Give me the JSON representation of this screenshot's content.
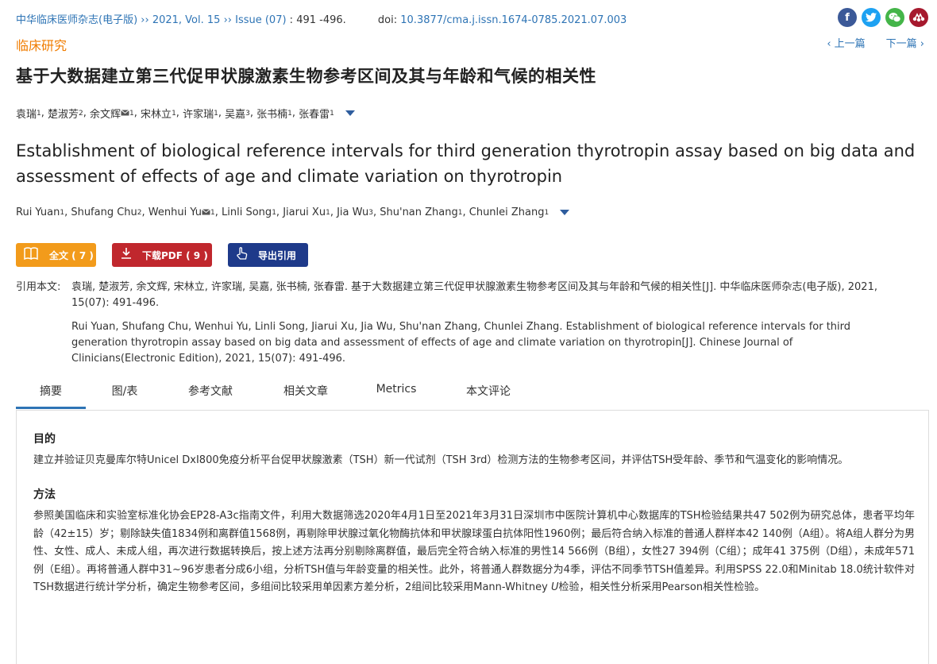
{
  "header": {
    "journal": "中华临床医师杂志(电子版)",
    "sep1": " ›› ",
    "year_vol": "2021, Vol. 15",
    "sep2": " ›› ",
    "issue": "Issue (07)",
    "pages": " : 491 -496.",
    "doi_label": "doi:",
    "doi": "10.3877/cma.j.issn.1674-0785.2021.07.003"
  },
  "social": {
    "facebook": "f",
    "twitter": "t",
    "wechat": "w",
    "mendeley": "m"
  },
  "category": "临床研究",
  "nav": {
    "prev": "‹  上一篇",
    "next": "下一篇  ›"
  },
  "title_cn": "基于大数据建立第三代促甲状腺激素生物参考区间及其与年龄和气候的相关性",
  "authors_cn": [
    {
      "name": "袁瑞",
      "sup": "1"
    },
    {
      "name": "楚淑芳",
      "sup": "2"
    },
    {
      "name": "余文辉",
      "sup": "1",
      "mail": true
    },
    {
      "name": "宋林立",
      "sup": "1"
    },
    {
      "name": "许家瑞",
      "sup": "1"
    },
    {
      "name": "吴嘉",
      "sup": "3"
    },
    {
      "name": "张书楠",
      "sup": "1"
    },
    {
      "name": "张春雷",
      "sup": "1"
    }
  ],
  "title_en": "Establishment of biological reference intervals for third generation thyrotropin assay based on big data and assessment of effects of age and climate variation on thyrotropin",
  "authors_en": [
    {
      "name": "Rui Yuan",
      "sup": "1"
    },
    {
      "name": "Shufang Chu",
      "sup": "2"
    },
    {
      "name": "Wenhui Yu",
      "sup": "1",
      "mail": true
    },
    {
      "name": "Linli Song",
      "sup": "1"
    },
    {
      "name": "Jiarui Xu",
      "sup": "1"
    },
    {
      "name": "Jia Wu",
      "sup": "3"
    },
    {
      "name": "Shu'nan Zhang",
      "sup": "1"
    },
    {
      "name": "Chunlei Zhang",
      "sup": "1"
    }
  ],
  "buttons": {
    "fulltext": "全文 ( 7 )",
    "pdf": "下载PDF ( 9 )",
    "cite": "导出引用"
  },
  "citation": {
    "label": "引用本文:",
    "cn": "袁瑞, 楚淑芳, 余文辉, 宋林立, 许家瑞, 吴嘉, 张书楠, 张春雷. 基于大数据建立第三代促甲状腺激素生物参考区间及其与年龄和气候的相关性[J]. 中华临床医师杂志(电子版), 2021, 15(07): 491-496.",
    "en": "Rui Yuan, Shufang Chu, Wenhui Yu, Linli Song, Jiarui Xu, Jia Wu, Shu'nan Zhang, Chunlei Zhang. Establishment of biological reference intervals for third generation thyrotropin assay based on big data and assessment of effects of age and climate variation on thyrotropin[J]. Chinese Journal of Clinicians(Electronic Edition), 2021, 15(07): 491-496."
  },
  "tabs": [
    "摘要",
    "图/表",
    "参考文献",
    "相关文章",
    "Metrics",
    "本文评论"
  ],
  "abstract": {
    "objective_h": "目的",
    "objective": "建立并验证贝克曼库尔特Unicel DxI800免疫分析平台促甲状腺激素（TSH）新一代试剂（TSH 3rd）检测方法的生物参考区间，并评估TSH受年龄、季节和气温变化的影响情况。",
    "methods_h": "方法",
    "methods_a": "参照美国临床和实验室标准化协会EP28-A3c指南文件，利用大数据筛选2020年4月1日至2021年3月31日深圳市中医院计算机中心数据库的TSH检验结果共47 502例为研究总体，患者平均年龄（42±15）岁；剔除缺失值1834例和离群值1568例，再剔除甲状腺过氧化物酶抗体和甲状腺球蛋白抗体阳性1960例；最后符合纳入标准的普通人群样本42 140例（A组）。将A组人群分为男性、女性、成人、未成人组，再次进行数据转换后，按上述方法再分别剔除离群值，最后完全符合纳入标准的男性14 566例（B组），女性27 394例（C组）；成年41 375例（D组），未成年571例（E组）。再将普通人群中31~96岁患者分成6小组，分析TSH值与年龄变量的相关性。此外，将普通人群数据分为4季，评估不同季节TSH值差异。利用SPSS 22.0和Minitab 18.0统计软件对TSH数据进行统计学分析，确定生物参考区间，多组间比较采用单因素方差分析，2组间比较采用Mann-Whitney ",
    "methods_u": "U",
    "methods_b": "检验，相关性分析采用Pearson相关性检验。"
  }
}
